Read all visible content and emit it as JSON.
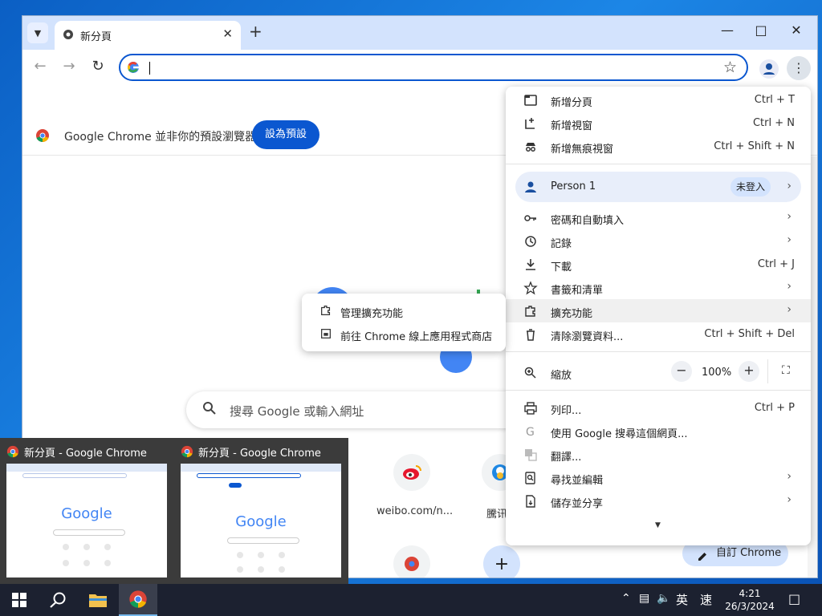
{
  "browser": {
    "tab_title": "新分頁",
    "omnibox_value": "",
    "default_banner_text": "Google Chrome 並非你的預設瀏覽器",
    "default_button_label": "設為預設",
    "ntp_search_placeholder": "搜尋 Google 或輸入網址",
    "shortcuts": [
      {
        "label": "weibo.com/n...",
        "icon": "weibo-icon"
      },
      {
        "label": "騰讯",
        "icon": "tencent-icon"
      }
    ],
    "customize_label": "自訂 Chrome"
  },
  "menu": {
    "items_top": [
      {
        "label": "新增分頁",
        "shortcut": "Ctrl + T",
        "icon": "new-tab-icon"
      },
      {
        "label": "新增視窗",
        "shortcut": "Ctrl + N",
        "icon": "new-window-icon"
      },
      {
        "label": "新增無痕視窗",
        "shortcut": "Ctrl + Shift + N",
        "icon": "incognito-icon"
      }
    ],
    "profile_name": "Person 1",
    "profile_status": "未登入",
    "items_mid": [
      {
        "label": "密碼和自動填入",
        "shortcut": "",
        "icon": "key-icon"
      },
      {
        "label": "記錄",
        "shortcut": "",
        "icon": "history-icon"
      },
      {
        "label": "下載",
        "shortcut": "Ctrl + J",
        "icon": "download-icon"
      },
      {
        "label": "書籤和清單",
        "shortcut": "",
        "icon": "star-icon"
      },
      {
        "label": "擴充功能",
        "shortcut": "",
        "icon": "extension-icon"
      },
      {
        "label": "清除瀏覽資料...",
        "shortcut": "Ctrl + Shift + Del",
        "icon": "trash-icon"
      }
    ],
    "zoom_label": "縮放",
    "zoom_value": "100%",
    "items_bottom": [
      {
        "label": "列印...",
        "shortcut": "Ctrl + P",
        "icon": "print-icon"
      },
      {
        "label": "使用 Google 搜尋這個網頁...",
        "shortcut": "",
        "icon": "google-g-icon"
      },
      {
        "label": "翻譯...",
        "shortcut": "",
        "icon": "translate-icon"
      },
      {
        "label": "尋找並編輯",
        "shortcut": "",
        "icon": "find-icon"
      },
      {
        "label": "儲存並分享",
        "shortcut": "",
        "icon": "save-share-icon"
      }
    ]
  },
  "submenu": {
    "items": [
      {
        "label": "管理擴充功能",
        "icon": "extension-icon"
      },
      {
        "label": "前往 Chrome 線上應用程式商店",
        "icon": "web-store-icon"
      }
    ]
  },
  "thumbnails": [
    {
      "title": "新分頁 - Google Chrome",
      "logo": "Google"
    },
    {
      "title": "新分頁 - Google Chrome",
      "logo": "Google"
    }
  ],
  "taskbar": {
    "ime": "英",
    "mode": "速",
    "time": "4:21",
    "date": "26/3/2024"
  }
}
